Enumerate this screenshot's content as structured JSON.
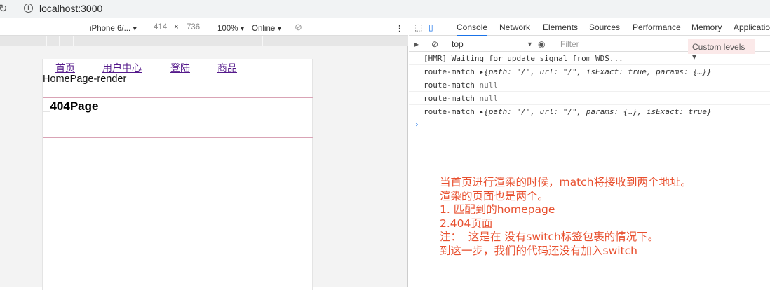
{
  "browser": {
    "url": "localhost:3000"
  },
  "device_toolbar": {
    "device": "iPhone 6/...",
    "width": "414",
    "x": "×",
    "height": "736",
    "zoom": "100%",
    "network": "Online"
  },
  "page": {
    "nav": [
      "首页",
      "用户中心",
      "登陆",
      "商品"
    ],
    "homepage_text": "HomePage-render",
    "page404_text": "_404Page"
  },
  "devtools": {
    "tabs": [
      "Console",
      "Network",
      "Elements",
      "Sources",
      "Performance",
      "Memory",
      "Application"
    ],
    "context": "top",
    "filter_placeholder": "Filter",
    "levels": "Custom levels ▾",
    "logs": [
      {
        "text": "[HMR] Waiting for update signal from WDS..."
      },
      {
        "label": "route-match",
        "value": "{path: \"/\", url: \"/\", isExact: true, params: {…}}"
      },
      {
        "label": "route-match",
        "value": "null"
      },
      {
        "label": "route-match",
        "value": "null"
      },
      {
        "label": "route-match",
        "value": "{path: \"/\", url: \"/\", params: {…}, isExact: true}"
      }
    ],
    "prompt": "›"
  },
  "annotation": [
    "当首页进行渲染的时候，match将接收到两个地址。",
    "渲染的页面也是两个。",
    "1. 匹配到的homepage",
    "2.404页面",
    "注：  这是在 没有switch标签包裹的情况下。",
    "到这一步，我们的代码还没有加入switch"
  ]
}
